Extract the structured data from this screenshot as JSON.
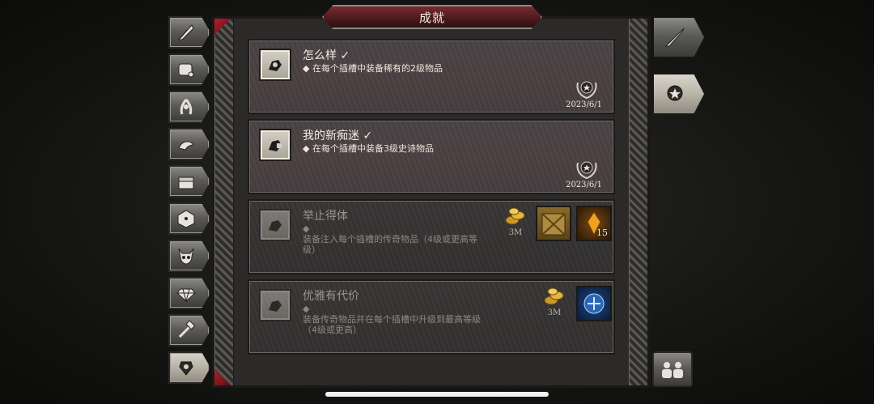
{
  "header": {
    "title": "成就"
  },
  "left_nav": [
    {
      "icon": "quill-icon"
    },
    {
      "icon": "scroll-icon"
    },
    {
      "icon": "laurel-icon"
    },
    {
      "icon": "dragon-icon"
    },
    {
      "icon": "chest-icon"
    },
    {
      "icon": "dice-icon"
    },
    {
      "icon": "demon-skull-icon"
    },
    {
      "icon": "gem-icon"
    },
    {
      "icon": "crafting-hammers-icon"
    },
    {
      "icon": "achievement-badge-icon"
    }
  ],
  "right_nav": [
    {
      "icon": "sword-icon"
    },
    {
      "icon": "medal-icon"
    },
    {
      "icon": "group-icon"
    }
  ],
  "achievements": [
    {
      "name": "怎么样 ✓",
      "desc": "◆ 在每个插槽中装备稀有的2级物品",
      "date": "2023/6/1",
      "status": "completed"
    },
    {
      "name": "我的新痴迷 ✓",
      "desc": "◆ 在每个插槽中装备3级史诗物品",
      "date": "2023/6/1",
      "status": "completed"
    },
    {
      "name": "举止得体",
      "desc_bullet": "◆",
      "desc": "装备注入每个插槽的传奇物品（4级或更高等级）",
      "status": "locked",
      "rewards": {
        "coin_amount": "3M",
        "crate_icon": "wooden-crate-icon",
        "shard_count": "15"
      }
    },
    {
      "name": "优雅有代价",
      "desc_bullet": "◆",
      "desc": "装备传奇物品并在每个插槽中升级到最高等级（4级或更高）",
      "status": "locked",
      "rewards": {
        "coin_amount": "3M",
        "emblem_icon": "blue-emblem-icon"
      }
    }
  ],
  "colors": {
    "accent_red": "#b0202a",
    "banner": "#4e1a1f",
    "panel": "#2b2a28"
  }
}
